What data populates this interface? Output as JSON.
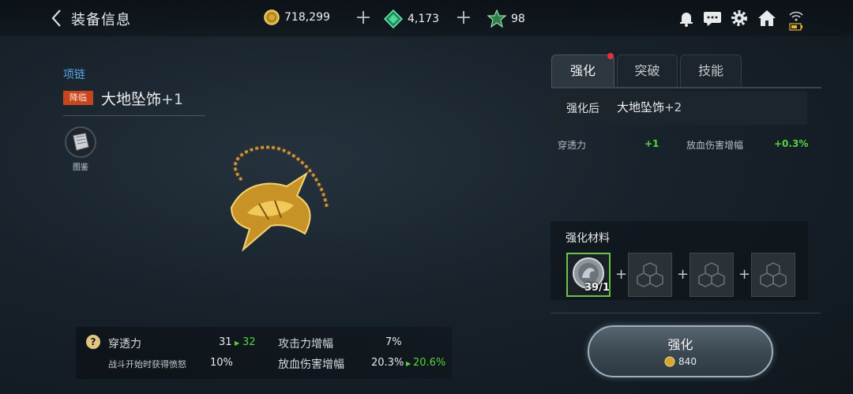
{
  "header": {
    "title": "装备信息",
    "gold": "718,299",
    "gems": "4,173",
    "stamina": "98"
  },
  "item": {
    "category": "项链",
    "badge": "降临",
    "name": "大地坠饰",
    "level": "+1",
    "codex_label": "图鉴"
  },
  "stats": {
    "row1": {
      "label": "穿透力",
      "current": "31",
      "next": "32",
      "label2": "攻击力增幅",
      "value2": "7%"
    },
    "row2": {
      "label": "战斗开始时获得愤怒",
      "value": "10%",
      "label2": "放血伤害增幅",
      "current": "20.3%",
      "next": "20.6%"
    }
  },
  "tabs": [
    {
      "label": "强化",
      "active": true
    },
    {
      "label": "突破",
      "active": false
    },
    {
      "label": "技能",
      "active": false
    }
  ],
  "enhance": {
    "after_label": "强化后",
    "after_name": "大地坠饰",
    "after_level": "+2",
    "bonus": [
      {
        "label": "穿透力",
        "value": "+1"
      },
      {
        "label": "放血伤害增幅",
        "value": "+0.3%"
      }
    ],
    "materials_title": "强化材料",
    "material_count": "39/1",
    "button_label": "强化",
    "cost": "840"
  },
  "colors": {
    "accent_green": "#56d53b",
    "badge_red": "#c8461e",
    "category_blue": "#5aa6e6",
    "gold": "#e2c680"
  }
}
